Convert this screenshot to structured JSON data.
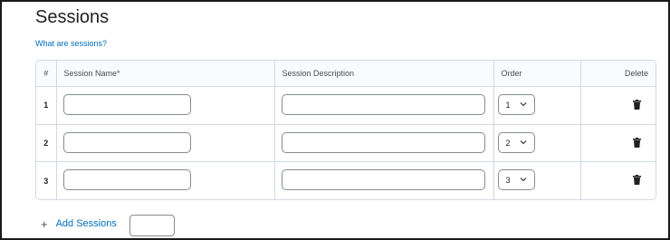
{
  "page": {
    "title": "Sessions",
    "help_link": "What are sessions?"
  },
  "table": {
    "headers": {
      "number": "#",
      "name": "Session Name*",
      "description": "Session Description",
      "order": "Order",
      "delete": "Delete"
    },
    "rows": [
      {
        "number": "1",
        "name": "",
        "description": "",
        "order": "1"
      },
      {
        "number": "2",
        "name": "",
        "description": "",
        "order": "2"
      },
      {
        "number": "3",
        "name": "",
        "description": "",
        "order": "3"
      }
    ]
  },
  "add_sessions": {
    "label": "Add Sessions",
    "plus": "+",
    "count_value": ""
  },
  "icons": {
    "delete": "trash-icon",
    "dropdown": "chevron-down-icon",
    "add": "plus-icon"
  },
  "colors": {
    "link": "#006fbf",
    "border": "#d3d9e3",
    "input_border": "#868c8f"
  }
}
